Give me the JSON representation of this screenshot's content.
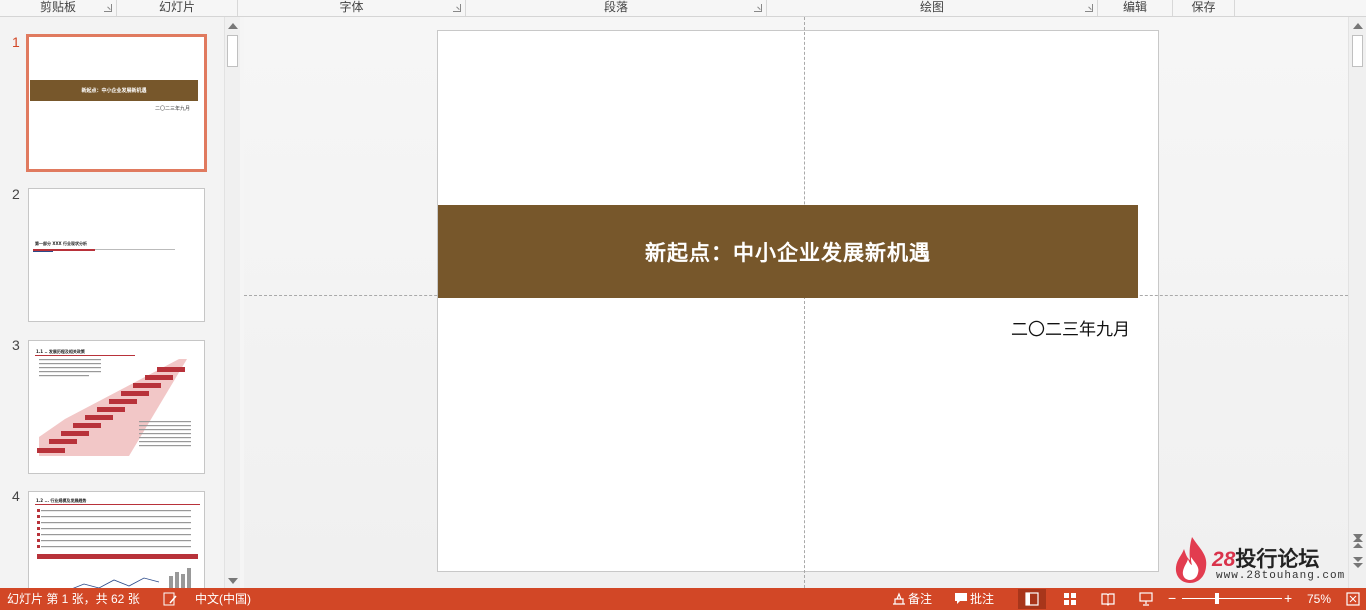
{
  "ribbon": {
    "groups": [
      {
        "label": "剪贴板"
      },
      {
        "label": "幻灯片"
      },
      {
        "label": "字体"
      },
      {
        "label": "段落"
      },
      {
        "label": "绘图"
      },
      {
        "label": "编辑"
      },
      {
        "label": "保存"
      }
    ]
  },
  "thumbnails": [
    {
      "number": "1",
      "title": "新起点：中小企业发展新机遇",
      "date": "二〇二三年九月"
    },
    {
      "number": "2",
      "title": "第一部分 XXX 行业现状分析"
    },
    {
      "number": "3",
      "title": "1.1 .. 发展历程及相关政策"
    },
    {
      "number": "4",
      "title": "1.2 ... 行业规模及发展趋势"
    }
  ],
  "slide": {
    "title": "新起点：中小企业发展新机遇",
    "subtitle": "二〇二三年九月",
    "band_color": "#77572b"
  },
  "watermark": {
    "number": "28",
    "name": "投行论坛",
    "url": "www.28touhang.com"
  },
  "status": {
    "slide_info": "幻灯片 第 1 张，共 62 张",
    "language": "中文(中国)",
    "notes_label": "备注",
    "comments_label": "批注",
    "zoom_minus": "−",
    "zoom_plus": "+",
    "zoom_level": "75%",
    "accent": "#d24726"
  }
}
